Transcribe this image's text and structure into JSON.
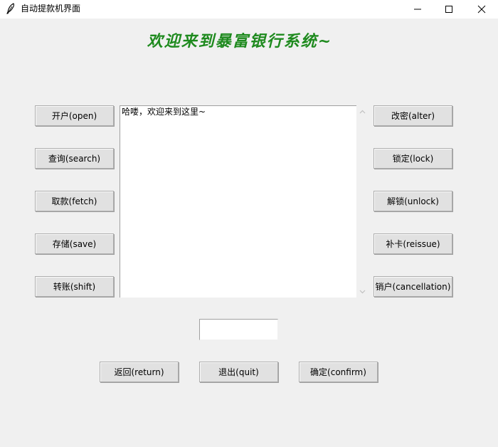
{
  "window": {
    "title": "自动提款机界面"
  },
  "heading": "欢迎来到暴富银行系统~",
  "left_buttons": [
    {
      "label": "开户(open)"
    },
    {
      "label": "查询(search)"
    },
    {
      "label": "取款(fetch)"
    },
    {
      "label": "存储(save)"
    },
    {
      "label": "转账(shift)"
    }
  ],
  "right_buttons": [
    {
      "label": "改密(alter)"
    },
    {
      "label": "锁定(lock)"
    },
    {
      "label": "解锁(unlock)"
    },
    {
      "label": "补卡(reissue)"
    },
    {
      "label": "销户(cancellation)"
    }
  ],
  "output": {
    "text": "哈喽，欢迎来到这里~"
  },
  "entry": {
    "value": ""
  },
  "bottom_buttons": [
    {
      "label": "返回(return)"
    },
    {
      "label": "退出(quit)"
    },
    {
      "label": "确定(confirm)"
    }
  ],
  "colors": {
    "heading": "#1e8a1e",
    "background": "#f0f0f0",
    "button_face": "#e1e1e1"
  }
}
